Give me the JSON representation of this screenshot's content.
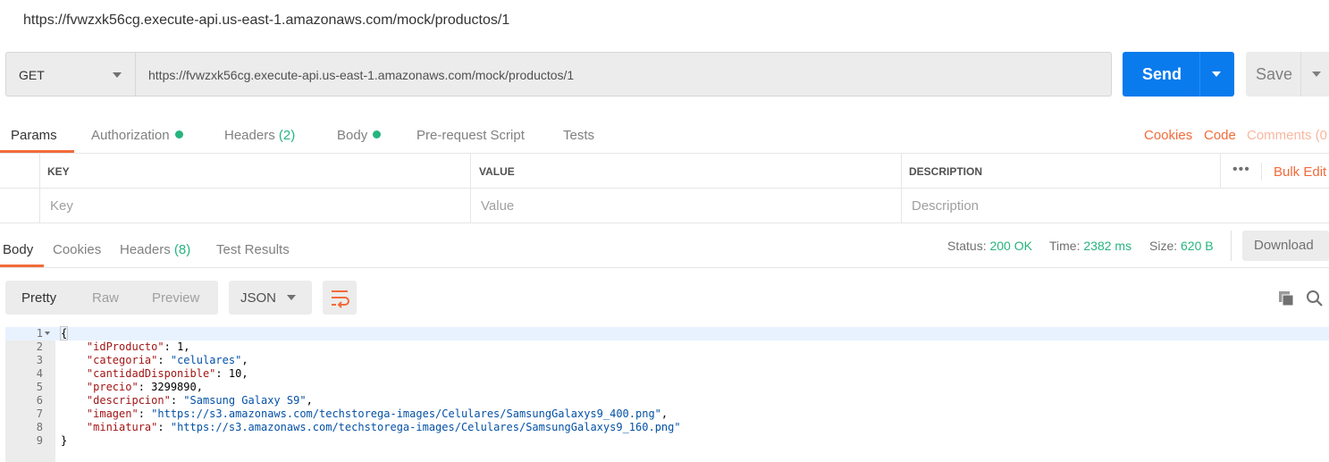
{
  "request_title": "https://fvwzxk56cg.execute-api.us-east-1.amazonaws.com/mock/productos/1",
  "url_bar": {
    "method": "GET",
    "url": "https://fvwzxk56cg.execute-api.us-east-1.amazonaws.com/mock/productos/1",
    "send_label": "Send",
    "save_label": "Save"
  },
  "request_tabs": {
    "params": "Params",
    "authorization": "Authorization",
    "headers": "Headers",
    "headers_count": "(2)",
    "body": "Body",
    "pre_request": "Pre-request Script",
    "tests": "Tests",
    "cookies": "Cookies",
    "code": "Code",
    "comments": "Comments (0"
  },
  "params_table": {
    "headers": [
      "KEY",
      "VALUE",
      "DESCRIPTION"
    ],
    "more": "•••",
    "bulk_edit": "Bulk Edit",
    "placeholders": [
      "Key",
      "Value",
      "Description"
    ]
  },
  "response_tabs": {
    "body": "Body",
    "cookies": "Cookies",
    "headers": "Headers",
    "headers_count": "(8)",
    "test_results": "Test Results"
  },
  "response_meta": {
    "status_label": "Status:",
    "status_value": "200 OK",
    "time_label": "Time:",
    "time_value": "2382 ms",
    "size_label": "Size:",
    "size_value": "620 B",
    "download": "Download"
  },
  "body_toolbar": {
    "pretty": "Pretty",
    "raw": "Raw",
    "preview": "Preview",
    "format": "JSON"
  },
  "response_body": {
    "line_numbers": [
      "1",
      "2",
      "3",
      "4",
      "5",
      "6",
      "7",
      "8",
      "9"
    ],
    "open_brace": "{",
    "close_brace": "}",
    "fields": [
      {
        "key": "\"idProducto\"",
        "value": "1",
        "type": "num"
      },
      {
        "key": "\"categoria\"",
        "value": "\"celulares\"",
        "type": "str"
      },
      {
        "key": "\"cantidadDisponible\"",
        "value": "10",
        "type": "num"
      },
      {
        "key": "\"precio\"",
        "value": "3299890",
        "type": "num"
      },
      {
        "key": "\"descripcion\"",
        "value": "\"Samsung Galaxy S9\"",
        "type": "str"
      },
      {
        "key": "\"imagen\"",
        "value": "\"https://s3.amazonaws.com/techstorega-images/Celulares/SamsungGalaxys9_400.png\"",
        "type": "str"
      },
      {
        "key": "\"miniatura\"",
        "value": "\"https://s3.amazonaws.com/techstorega-images/Celulares/SamsungGalaxys9_160.png\"",
        "type": "str"
      }
    ]
  },
  "colors": {
    "accent": "#f26b3a",
    "primary": "#097bed",
    "success": "#26b47f"
  },
  "icons": [
    "chevron-down-icon",
    "wrap-lines-icon",
    "copy-icon",
    "search-icon"
  ]
}
